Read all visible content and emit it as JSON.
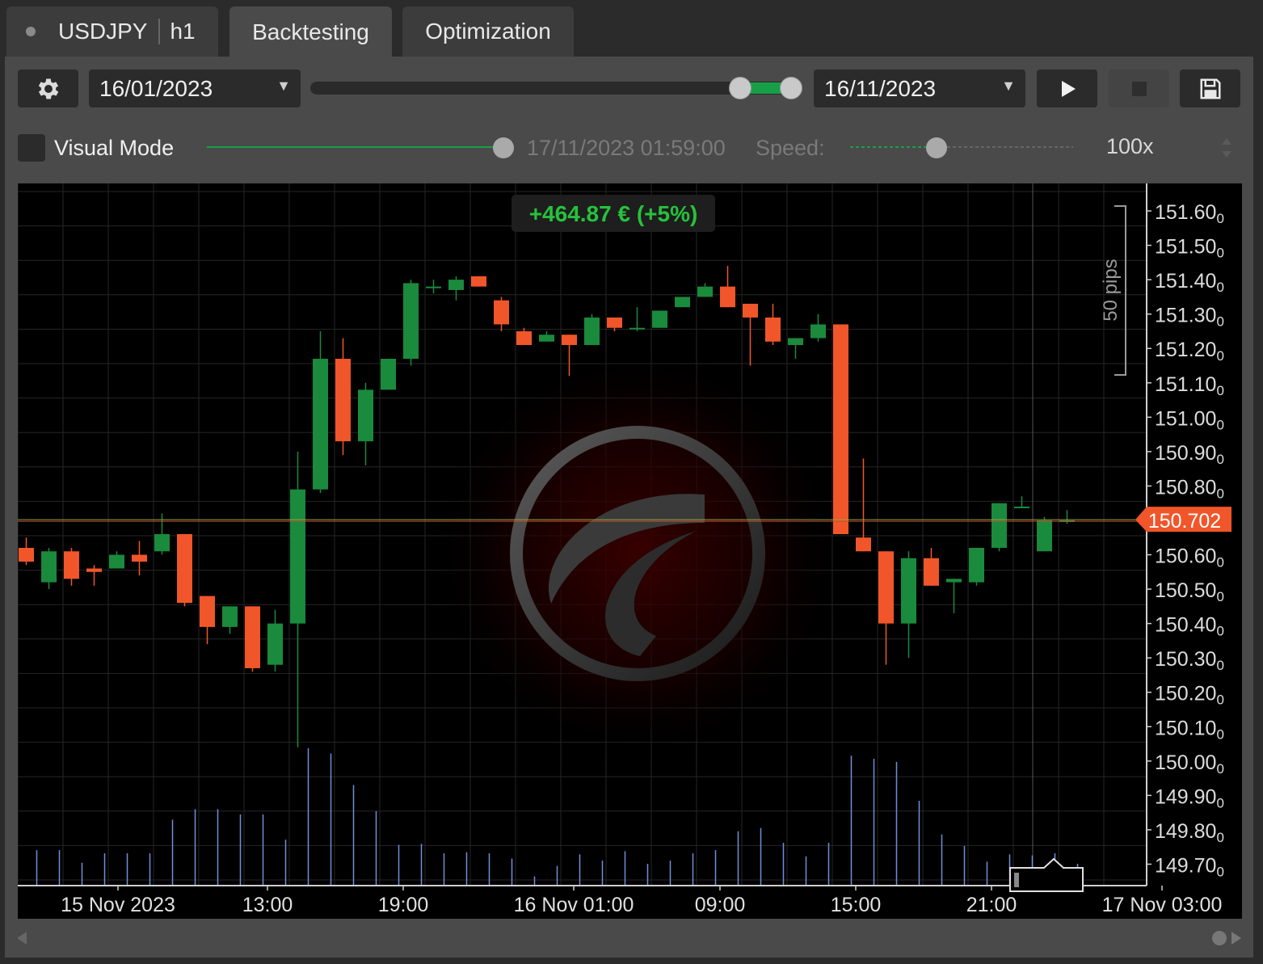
{
  "tabs": {
    "symbol": "USDJPY",
    "timeframe": "h1",
    "backtesting": "Backtesting",
    "optimization": "Optimization"
  },
  "toolbar": {
    "start_date": "16/01/2023",
    "end_date": "16/11/2023",
    "range_start_fraction": 0.9,
    "range_end_fraction": 1.0
  },
  "visual_mode": {
    "label": "Visual Mode",
    "checked": false,
    "timestamp": "17/11/2023 01:59:00",
    "speed_label": "Speed:",
    "speed_value": "100x"
  },
  "chart_data": {
    "type": "candlestick",
    "symbol": "USDJPY",
    "timeframe": "h1",
    "pnl_badge": "+464.87 € (+5%)",
    "current_price": "150.702",
    "ruler_label": "50 pips",
    "y_ticks": [
      "151.60",
      "151.50",
      "151.40",
      "151.30",
      "151.20",
      "151.10",
      "151.00",
      "150.90",
      "150.80",
      "150.60",
      "150.50",
      "150.40",
      "150.30",
      "150.20",
      "150.10",
      "150.00",
      "149.90",
      "149.80",
      "149.70"
    ],
    "tick_suffix": "0",
    "x_ticks": [
      "15 Nov 2023",
      "13:00",
      "19:00",
      "16 Nov 01:00",
      "09:00",
      "15:00",
      "21:00",
      "17 Nov 03:00"
    ],
    "candles": [
      [
        150.62,
        150.58,
        150.65,
        150.57
      ],
      [
        150.52,
        150.61,
        150.62,
        150.5
      ],
      [
        150.61,
        150.53,
        150.62,
        150.51
      ],
      [
        150.56,
        150.55,
        150.57,
        150.51
      ],
      [
        150.56,
        150.6,
        150.61,
        150.56
      ],
      [
        150.6,
        150.58,
        150.64,
        150.54
      ],
      [
        150.61,
        150.66,
        150.72,
        150.6
      ],
      [
        150.66,
        150.46,
        150.66,
        150.45
      ],
      [
        150.48,
        150.39,
        150.48,
        150.34
      ],
      [
        150.39,
        150.45,
        150.45,
        150.37
      ],
      [
        150.45,
        150.27,
        150.45,
        150.26
      ],
      [
        150.28,
        150.4,
        150.44,
        150.26
      ],
      [
        150.4,
        150.79,
        150.9,
        150.04
      ],
      [
        150.79,
        151.17,
        151.25,
        150.78
      ],
      [
        151.17,
        150.93,
        151.23,
        150.89
      ],
      [
        150.93,
        151.08,
        151.1,
        150.86
      ],
      [
        151.08,
        151.17,
        151.17,
        151.08
      ],
      [
        151.17,
        151.39,
        151.4,
        151.15
      ],
      [
        151.38,
        151.38,
        151.4,
        151.36
      ],
      [
        151.37,
        151.4,
        151.41,
        151.34
      ],
      [
        151.41,
        151.38,
        151.41,
        151.38
      ],
      [
        151.34,
        151.27,
        151.35,
        151.25
      ],
      [
        151.25,
        151.21,
        151.26,
        151.21
      ],
      [
        151.22,
        151.24,
        151.25,
        151.22
      ],
      [
        151.24,
        151.21,
        151.24,
        151.12
      ],
      [
        151.21,
        151.29,
        151.3,
        151.21
      ],
      [
        151.29,
        151.26,
        151.29,
        151.25
      ],
      [
        151.26,
        151.26,
        151.32,
        151.25
      ],
      [
        151.26,
        151.31,
        151.31,
        151.26
      ],
      [
        151.32,
        151.35,
        151.35,
        151.32
      ],
      [
        151.35,
        151.38,
        151.39,
        151.35
      ],
      [
        151.38,
        151.32,
        151.44,
        151.32
      ],
      [
        151.33,
        151.29,
        151.33,
        151.15
      ],
      [
        151.29,
        151.22,
        151.33,
        151.21
      ],
      [
        151.21,
        151.23,
        151.23,
        151.17
      ],
      [
        151.23,
        151.27,
        151.3,
        151.22
      ],
      [
        151.27,
        150.66,
        151.27,
        150.66
      ],
      [
        150.65,
        150.61,
        150.88,
        150.61
      ],
      [
        150.61,
        150.4,
        150.61,
        150.28
      ],
      [
        150.4,
        150.59,
        150.61,
        150.3
      ],
      [
        150.59,
        150.51,
        150.62,
        150.51
      ],
      [
        150.52,
        150.53,
        150.53,
        150.43
      ],
      [
        150.52,
        150.62,
        150.62,
        150.51
      ],
      [
        150.62,
        150.75,
        150.75,
        150.61
      ],
      [
        150.74,
        150.74,
        150.77,
        150.74
      ],
      [
        150.61,
        150.7,
        150.71,
        150.61
      ],
      [
        150.7,
        150.7,
        150.73,
        150.69
      ]
    ],
    "volumes": [
      0.33,
      0.33,
      0.21,
      0.3,
      0.3,
      0.3,
      0.62,
      0.72,
      0.72,
      0.67,
      0.67,
      0.43,
      1.3,
      1.25,
      0.95,
      0.7,
      0.38,
      0.39,
      0.3,
      0.31,
      0.3,
      0.25,
      0.08,
      0.18,
      0.29,
      0.23,
      0.32,
      0.2,
      0.23,
      0.3,
      0.33,
      0.51,
      0.54,
      0.4,
      0.27,
      0.4,
      1.23,
      1.2,
      1.17,
      0.8,
      0.48,
      0.37,
      0.22,
      0.29,
      0.28,
      0.3,
      0.2
    ],
    "y_range": [
      149.64,
      151.68
    ],
    "colors": {
      "up": "#1a8a3c",
      "down": "#f0562a",
      "volume": "#6f8fd8",
      "price_tag": "#f0562a",
      "pnl": "#26c23c"
    },
    "grid": true
  }
}
